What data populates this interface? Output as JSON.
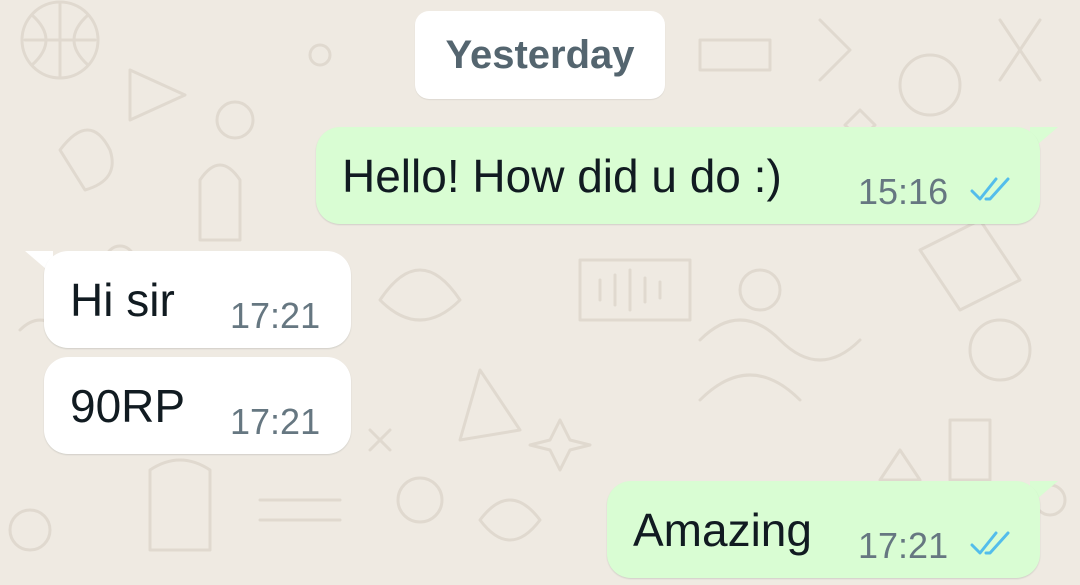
{
  "chat": {
    "date_divider": "Yesterday",
    "messages": [
      {
        "direction": "outgoing",
        "text": "Hello! How did u do :)",
        "time": "15:16",
        "status": "read"
      },
      {
        "direction": "incoming",
        "text": "Hi sir",
        "time": "17:21"
      },
      {
        "direction": "incoming",
        "text": "90RP",
        "time": "17:21"
      },
      {
        "direction": "outgoing",
        "text": "Amazing",
        "time": "17:21",
        "status": "read"
      }
    ]
  },
  "colors": {
    "background": "#efeae2",
    "outgoing_bubble": "#d9fdd3",
    "incoming_bubble": "#ffffff",
    "read_ticks": "#53bdeb"
  },
  "icons": {
    "read_receipt": "double-check-icon"
  }
}
